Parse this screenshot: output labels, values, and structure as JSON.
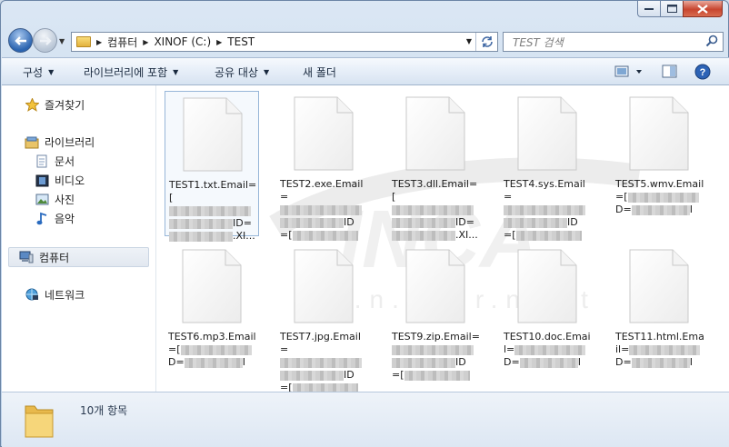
{
  "window": {
    "min_label": "–",
    "max_label": "□",
    "close_label": "✕"
  },
  "address": {
    "crumbs": [
      "컴퓨터",
      "XINOF  (C:)",
      "TEST"
    ],
    "search_placeholder": "TEST 검색"
  },
  "toolbar": {
    "organize": "구성",
    "include_library": "라이브러리에 포함",
    "share_with": "공유 대상",
    "new_folder": "새 폴더"
  },
  "nav": {
    "favorites": "즐겨찾기",
    "libraries": "라이브러리",
    "documents": "문서",
    "videos": "비디오",
    "pictures": "사진",
    "music": "음악",
    "computer": "컴퓨터",
    "network": "네트워크"
  },
  "files": [
    {
      "line1": "TEST1.txt.Email=[",
      "line3_end": "ID=",
      "line4_end": ".XI..."
    },
    {
      "line1": "TEST2.exe.Email=",
      "line3_end": "ID",
      "line4_start": "=["
    },
    {
      "line1": "TEST3.dll.Email=[",
      "line3_end": "ID=",
      "line4_end": ".XI..."
    },
    {
      "line1": "TEST4.sys.Email=",
      "line3_end": "ID",
      "line4_start": "=["
    },
    {
      "line1": "TEST5.wmv.Email",
      "line2_start": "=[",
      "line3_start": "D=",
      "line3_end": "I"
    },
    {
      "line1": "TEST6.mp3.Email",
      "line2_start": "=[",
      "line3_start": "D=",
      "line3_end": "I"
    },
    {
      "line1": "TEST7.jpg.Email=",
      "line3_end": "ID",
      "line4_start": "=["
    },
    {
      "line1": "TEST9.zip.Email=",
      "line3_end": "ID",
      "line4_start": "=["
    },
    {
      "line1": "TEST10.doc.Emai",
      "line2_start": "l=",
      "line3_start": "D=",
      "line3_end": "I"
    },
    {
      "line1": "TEST11.html.Ema",
      "line2_start": "il=",
      "line3_start": "D=",
      "line3_end": "I"
    }
  ],
  "watermark": {
    "brand": "INCA",
    "sub": "I.n.t.e.r.n.e.t"
  },
  "status": {
    "item_count": "10개 항목"
  }
}
